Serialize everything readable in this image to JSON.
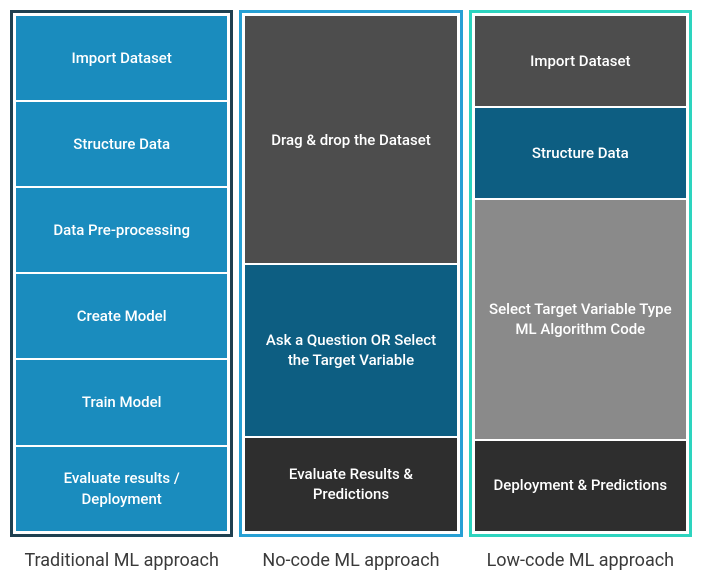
{
  "columns": {
    "traditional": {
      "label": "Traditional ML approach",
      "boxes": [
        "Import Dataset",
        "Structure Data",
        "Data Pre-processing",
        "Create Model",
        "Train Model",
        "Evaluate results / Deployment"
      ]
    },
    "nocode": {
      "label": "No-code ML approach",
      "boxes": [
        "Drag & drop the Dataset",
        "Ask a Question OR Select the Target Variable",
        "Evaluate Results & Predictions"
      ]
    },
    "lowcode": {
      "label": "Low-code ML approach",
      "boxes": [
        "Import Dataset",
        "Structure Data",
        "Select Target Variable Type ML Algorithm Code",
        "Deployment & Predictions"
      ]
    }
  }
}
